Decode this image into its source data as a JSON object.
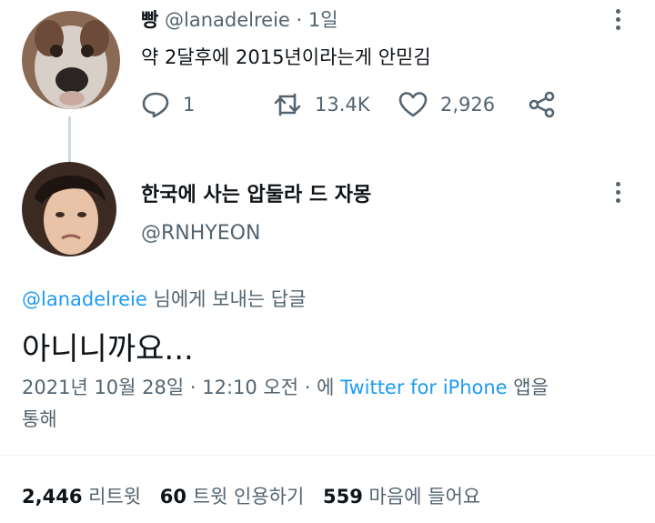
{
  "tweet1": {
    "author_name": "빵",
    "handle": "@lanadelreie",
    "time": "· 1일",
    "text": "약 2달후에 2015년이라는게 안믿김",
    "replies": "1",
    "retweets": "13.4K",
    "likes": "2,926",
    "avatar_icon": "dog-face-avatar"
  },
  "tweet2": {
    "author_name": "한국에 사는 압둘라 드 자몽",
    "handle": "@RNHYEON",
    "reply_to_handle": "@lanadelreie",
    "reply_to_suffix": "님에게 보내는 답글",
    "text": "아니니까요...",
    "timestamp": "2021년 10월 28일 · 12:10 오전 · 에",
    "source": "Twitter for iPhone",
    "source_suffix": "앱을",
    "source_suffix2": "통해",
    "avatar_icon": "person-face-avatar"
  },
  "stats": {
    "retweets_count": "2,446",
    "retweets_label": "리트윗",
    "quotes_count": "60",
    "quotes_label": "트윗 인용하기",
    "likes_count": "559",
    "likes_label": "마음에 들어요"
  },
  "colors": {
    "accent": "#1d9bf0",
    "muted": "#536471",
    "text": "#0f1419"
  }
}
